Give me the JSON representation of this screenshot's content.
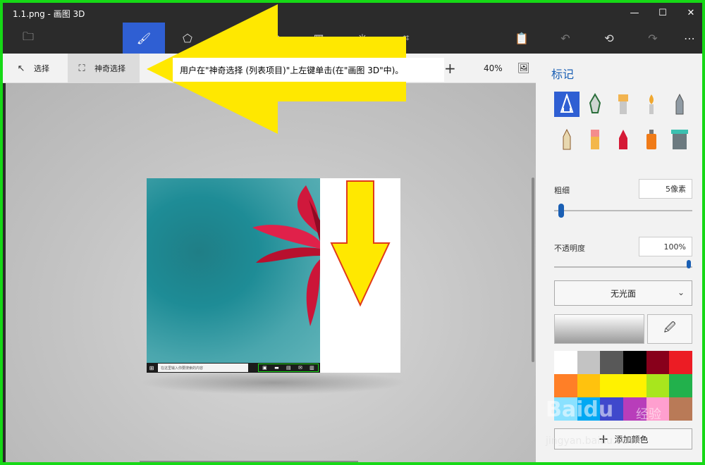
{
  "window": {
    "title": "1.1.png - 画图 3D",
    "minimize": "—",
    "maximize": "☐",
    "close": "✕"
  },
  "toolbar": {
    "items": [
      {
        "name": "menu-folder-icon",
        "glyph": "🗀"
      },
      {
        "name": "brushes-icon",
        "glyph": "🖌",
        "active": true
      },
      {
        "name": "2d-shapes-icon",
        "glyph": "⬠"
      },
      {
        "name": "3d-shapes-icon",
        "glyph": "⬡"
      },
      {
        "name": "stickers-icon",
        "glyph": "▦"
      },
      {
        "name": "effects-icon",
        "glyph": "✳"
      },
      {
        "name": "crop-icon",
        "glyph": "⌗"
      },
      {
        "name": "paste-icon",
        "glyph": "📋"
      },
      {
        "name": "undo-icon",
        "glyph": "↶",
        "disabled": true
      },
      {
        "name": "history-icon",
        "glyph": "⟲"
      },
      {
        "name": "redo-icon",
        "glyph": "↷",
        "disabled": true
      },
      {
        "name": "more-icon",
        "glyph": "⋯"
      }
    ]
  },
  "subbar": {
    "select_label": "选择",
    "magic_select_label": "神奇选择",
    "zoom_plus": "+",
    "zoom": "40%"
  },
  "annotation": {
    "text": "用户在\"神奇选择 (列表项目)\"上左键单击(在\"画图 3D\"中)。"
  },
  "canvas_image": {
    "taskbar_search": "在这里输入你要搜索的内容"
  },
  "panel": {
    "title": "标记",
    "tools": [
      {
        "name": "marker-icon",
        "glyph": "✎",
        "color": "#ffffff",
        "selected": true
      },
      {
        "name": "calligraphy-pen-icon",
        "glyph": "✒",
        "color": "#2a6e3a"
      },
      {
        "name": "oil-brush-icon",
        "glyph": "▮",
        "color": "#e8a040"
      },
      {
        "name": "watercolor-icon",
        "glyph": "✎",
        "color": "#e38a1b"
      },
      {
        "name": "pixel-pen-icon",
        "glyph": "✏",
        "color": "#777777"
      },
      {
        "name": "pencil-icon",
        "glyph": "✏",
        "color": "#8a5a2b"
      },
      {
        "name": "eraser-icon",
        "glyph": "▮",
        "color": "#e96a6a"
      },
      {
        "name": "crayon-icon",
        "glyph": "▲",
        "color": "#d0182e"
      },
      {
        "name": "spray-can-icon",
        "glyph": "▮",
        "color": "#f07b18"
      },
      {
        "name": "fill-bucket-icon",
        "glyph": "▮",
        "color": "#3bb3a8"
      }
    ],
    "thickness_label": "粗细",
    "thickness_value": "5像素",
    "thickness_level": 0.05,
    "opacity_label": "不透明度",
    "opacity_value": "100%",
    "opacity_level": 1.0,
    "finish": "无光面",
    "add_color": "添加颜色",
    "palette": [
      "#ffffff",
      "#c3c3c3",
      "#585858",
      "#000000",
      "#88001b",
      "#ec1c24",
      "#ff7f27",
      "#ffc20e",
      "#fff200",
      "#fff200",
      "#a8e61d",
      "#22b14c",
      "#8ae1ff",
      "#00a8f3",
      "#3f48cc",
      "#b83dba",
      "#ff9fcf",
      "#b97a57"
    ]
  },
  "watermark": {
    "brand": "Baidu",
    "product": "经验",
    "url": "jingyan.baidu.com"
  }
}
